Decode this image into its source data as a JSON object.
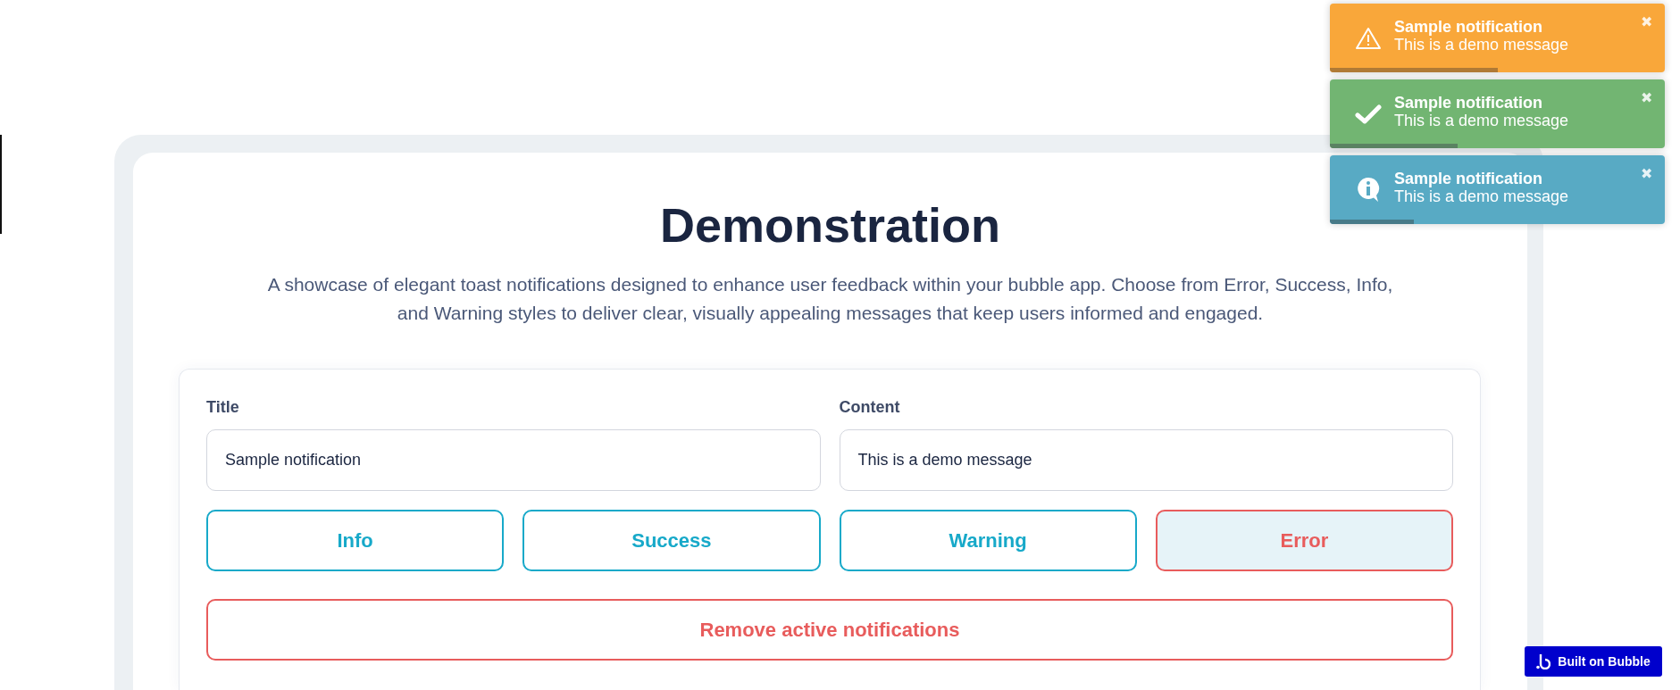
{
  "card": {
    "title": "Demonstration",
    "description": "A showcase of elegant toast notifications designed to enhance user feedback within your bubble app. Choose from Error, Success, Info, and Warning styles to deliver clear, visually appealing messages that keep users informed and engaged."
  },
  "form": {
    "fields": [
      {
        "label": "Title",
        "value": "Sample notification"
      },
      {
        "label": "Content",
        "value": "This is a demo message"
      }
    ],
    "buttons": [
      {
        "label": "Info",
        "kind": "neutral",
        "highlighted": false
      },
      {
        "label": "Success",
        "kind": "neutral",
        "highlighted": false
      },
      {
        "label": "Warning",
        "kind": "neutral",
        "highlighted": false
      },
      {
        "label": "Error",
        "kind": "danger",
        "highlighted": true
      }
    ],
    "remove_button": "Remove active notifications"
  },
  "toasts": [
    {
      "kind": "warning",
      "title": "Sample notification",
      "message": "This is a demo message",
      "close": "✖",
      "level": 0.5
    },
    {
      "kind": "success",
      "title": "Sample notification",
      "message": "This is a demo message",
      "close": "✖",
      "level": 0.38
    },
    {
      "kind": "info",
      "title": "Sample notification",
      "message": "This is a demo message",
      "close": "✖",
      "level": 0.25
    }
  ],
  "badge": "Built on Bubble"
}
